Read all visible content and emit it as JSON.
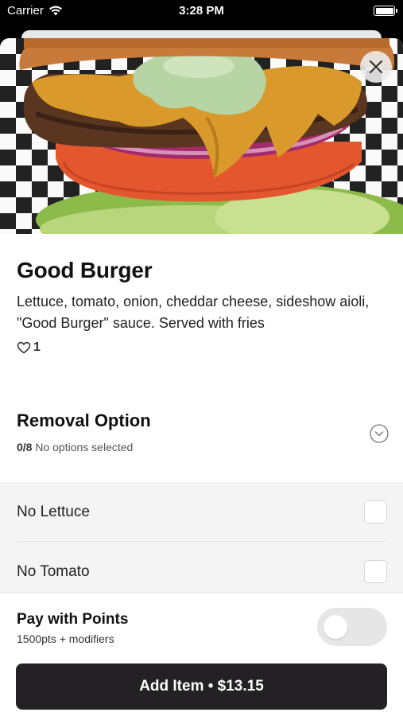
{
  "status_bar": {
    "carrier": "Carrier",
    "time": "3:28 PM"
  },
  "item": {
    "name": "Good Burger",
    "description": "Lettuce, tomato, onion, cheddar cheese, sideshow aioli, \"Good Burger\" sauce. Served with fries",
    "likes": "1"
  },
  "removal_section": {
    "title": "Removal Option",
    "count": "0/8",
    "status": "No options selected",
    "options": [
      {
        "label": "No Lettuce",
        "checked": false
      },
      {
        "label": "No Tomato",
        "checked": false
      }
    ]
  },
  "footer": {
    "pay_title": "Pay with Points",
    "pay_sub": "1500pts + modifiers",
    "pay_toggle_on": false,
    "add_button": "Add Item • $13.15"
  }
}
